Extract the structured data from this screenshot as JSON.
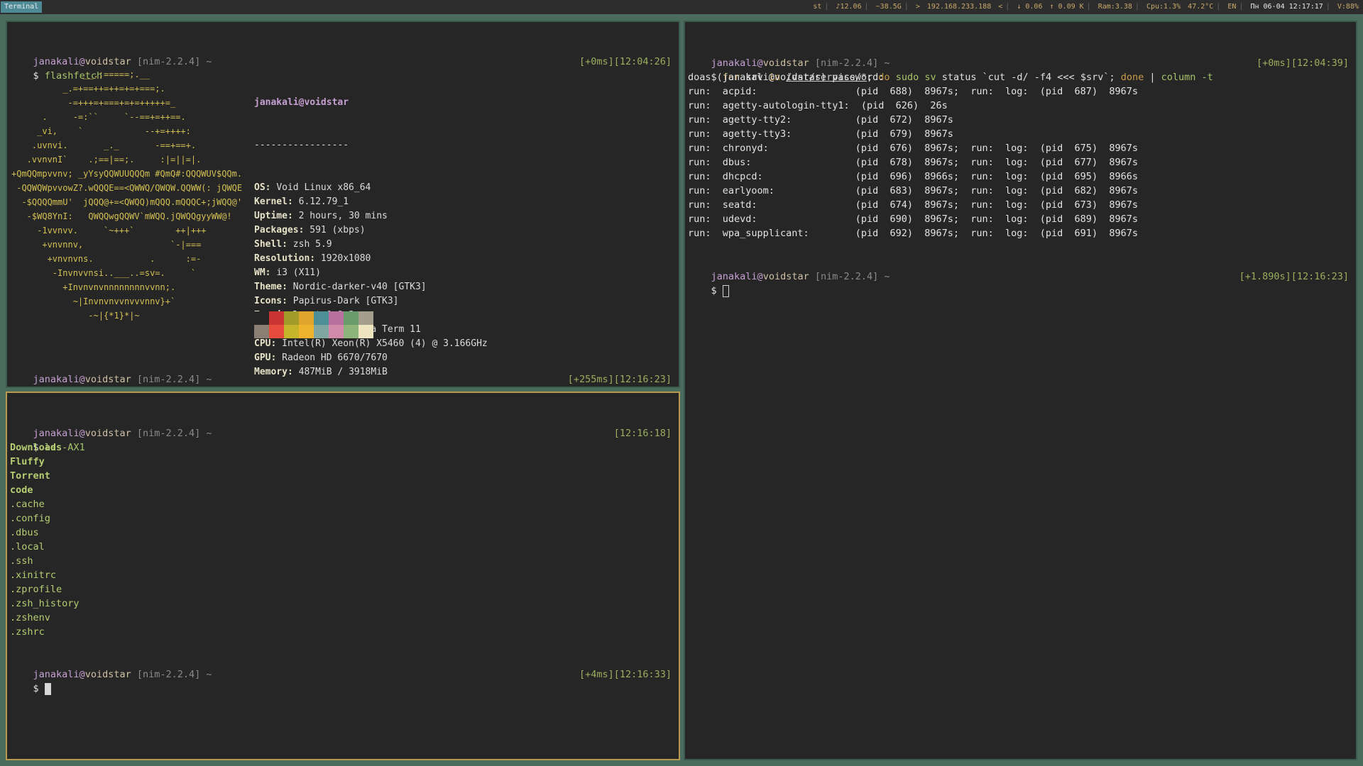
{
  "topbar": {
    "tab": "Terminal",
    "status": [
      "st",
      "♪12.06",
      "~38.5G",
      ">",
      "192.168.233.188",
      "<",
      "↓ 0.06",
      "↑ 0.09 K",
      "Ram:3.38",
      "Cpu:1.3%",
      "47.2°C",
      "EN",
      "Пн 06-04 12:17:17",
      "V:88%"
    ]
  },
  "prompt": {
    "user": "janakali",
    "at": "@",
    "host": "voidstar",
    "branch": "[nim-2.2.4]",
    "tilde": "~",
    "dollar": "$"
  },
  "pane_fetch": {
    "cmd": "flashfetch",
    "time1": "[+0ms][12:04:26]",
    "time2": "[+255ms][12:16:23]",
    "title": "janakali@voidstar",
    "underline": "-----------------",
    "art": [
      "              __.;=====;.__",
      "          _.=+==++=++=+=+===;.",
      "           -=+++=+===+=+=+++++=_",
      "      .     -=:``     `--==+=++==.",
      "     _vi,    `            --+=++++:",
      "    .uvnvi.       _._       -==+==+.",
      "   .vvnvnI`    .;==|==;.     :|=||=|.",
      "+QmQQmpvvnv; _yYsyQQWUUQQQm #QmQ#:QQQWUV$QQm.",
      " -QQWQWpvvowZ?.wQQQE==<QWWQ/QWQW.QQWW(: jQWQE",
      "  -$QQQQmmU'  jQQQ@+=<QWQQ)mQQQ.mQQQC+;jWQQ@'",
      "   -$WQ8YnI:   QWQQwgQQWV`mWQQ.jQWQQgyyWW@!",
      "     -1vvnvv.     `~+++`        ++|+++",
      "      +vnvnnv,                 `-|===",
      "       +vnvnvns.           .      :=-",
      "        -Invnvvnsi..___..=sv=.     `",
      "          +Invnvnvnnnnnnnnvvnn;.",
      "            ~|Invnvnvvnvvvnnv}+`",
      "               -~|{*1}*|~"
    ],
    "info": [
      {
        "k": "OS:",
        "v": "Void Linux x86_64"
      },
      {
        "k": "Kernel:",
        "v": "6.12.79_1"
      },
      {
        "k": "Uptime:",
        "v": "2 hours, 30 mins"
      },
      {
        "k": "Packages:",
        "v": "591 (xbps)"
      },
      {
        "k": "Shell:",
        "v": "zsh 5.9"
      },
      {
        "k": "Resolution:",
        "v": "1920x1080"
      },
      {
        "k": "WM:",
        "v": "i3 (X11)"
      },
      {
        "k": "Theme:",
        "v": "Nordic-darker-v40 [GTK3]"
      },
      {
        "k": "Icons:",
        "v": "Papirus-Dark [GTK3]"
      },
      {
        "k": "Terminal:",
        "v": "st 0.9.3"
      },
      {
        "k": "Terminal Font:",
        "v": "Iosevka Term 11"
      },
      {
        "k": "CPU:",
        "v": "Intel(R) Xeon(R) X5460 (4) @ 3.166GHz"
      },
      {
        "k": "GPU:",
        "v": "Radeon HD 6670/7670"
      },
      {
        "k": "Memory:",
        "v": "487MiB / 3918MiB"
      }
    ],
    "palette_top": [
      "#262626",
      "#cc3333",
      "#a29b2a",
      "#e0a52c",
      "#4d8f96",
      "#b8719e",
      "#6a9b6d",
      "#a59e8c"
    ],
    "palette_bottom": [
      "#8a7f72",
      "#e64b3c",
      "#c6b52a",
      "#f0b32e",
      "#7fa6a0",
      "#d28aa9",
      "#8db47a",
      "#efe4c0"
    ]
  },
  "pane_ls": {
    "cmd": "ls -AX1",
    "time1": "[12:16:18]",
    "time2": "[+4ms][12:16:33]",
    "entries": [
      "Downloads",
      "Fluffy",
      "Torrent",
      "code",
      ".cache",
      ".config",
      ".dbus",
      ".local",
      ".ssh",
      ".xinitrc",
      ".zprofile",
      ".zsh_history",
      ".zshenv",
      ".zshrc"
    ]
  },
  "pane_sv": {
    "cmd_parts": [
      "for",
      " srv ",
      "in",
      " ",
      "/var/service/*",
      "; ",
      "do",
      " ",
      "sudo",
      " ",
      "sv",
      " status `cut -d/ -f4 <<< $srv`; ",
      "done",
      " | ",
      "column -t"
    ],
    "time1": "[+0ms][12:04:39]",
    "time2": "[+1.890s][12:16:23]",
    "password_line": "doas (janakali@voidstar) password:",
    "rows": [
      "run:  acpid:                 (pid  688)  8967s;  run:  log:  (pid  687)  8967s",
      "run:  agetty-autologin-tty1:  (pid  626)  26s",
      "run:  agetty-tty2:           (pid  672)  8967s",
      "run:  agetty-tty3:           (pid  679)  8967s",
      "run:  chronyd:               (pid  676)  8967s;  run:  log:  (pid  675)  8967s",
      "run:  dbus:                  (pid  678)  8967s;  run:  log:  (pid  677)  8967s",
      "run:  dhcpcd:                (pid  696)  8966s;  run:  log:  (pid  695)  8966s",
      "run:  earlyoom:              (pid  683)  8967s;  run:  log:  (pid  682)  8967s",
      "run:  seatd:                 (pid  674)  8967s;  run:  log:  (pid  673)  8967s",
      "run:  udevd:                 (pid  690)  8967s;  run:  log:  (pid  689)  8967s",
      "run:  wpa_supplicant:        (pid  692)  8967s;  run:  log:  (pid  691)  8967s"
    ]
  }
}
